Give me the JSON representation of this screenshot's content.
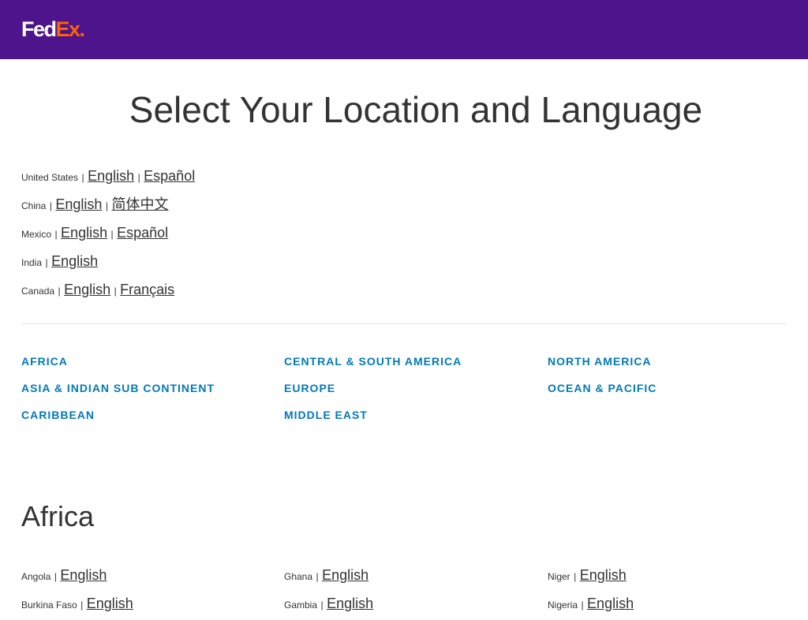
{
  "header": {
    "logo": {
      "part1": "Fed",
      "part2": "Ex",
      "dot": "."
    },
    "bg_color": "#4d148c"
  },
  "page_title": "Select Your Location and Language",
  "top_countries": [
    {
      "name": "United States",
      "languages": [
        "English",
        "Español"
      ]
    },
    {
      "name": "China",
      "languages": [
        "English",
        "简体中文"
      ]
    },
    {
      "name": "Mexico",
      "languages": [
        "English",
        "Español"
      ]
    },
    {
      "name": "India",
      "languages": [
        "English"
      ]
    },
    {
      "name": "Canada",
      "languages": [
        "English",
        "Français"
      ]
    }
  ],
  "separator": "|",
  "regions": {
    "link_color": "#007ab7",
    "columns": [
      [
        "AFRICA",
        "ASIA & INDIAN SUB CONTINENT",
        "CARIBBEAN"
      ],
      [
        "CENTRAL & SOUTH AMERICA",
        "EUROPE",
        "MIDDLE EAST"
      ],
      [
        "NORTH AMERICA",
        "OCEAN & PACIFIC"
      ]
    ]
  },
  "africa": {
    "title": "Africa",
    "columns": [
      [
        {
          "name": "Angola",
          "languages": [
            "English"
          ]
        },
        {
          "name": "Burkina Faso",
          "languages": [
            "English"
          ]
        }
      ],
      [
        {
          "name": "Ghana",
          "languages": [
            "English"
          ]
        },
        {
          "name": "Gambia",
          "languages": [
            "English"
          ]
        }
      ],
      [
        {
          "name": "Niger",
          "languages": [
            "English"
          ]
        },
        {
          "name": "Nigeria",
          "languages": [
            "English"
          ]
        }
      ]
    ]
  }
}
